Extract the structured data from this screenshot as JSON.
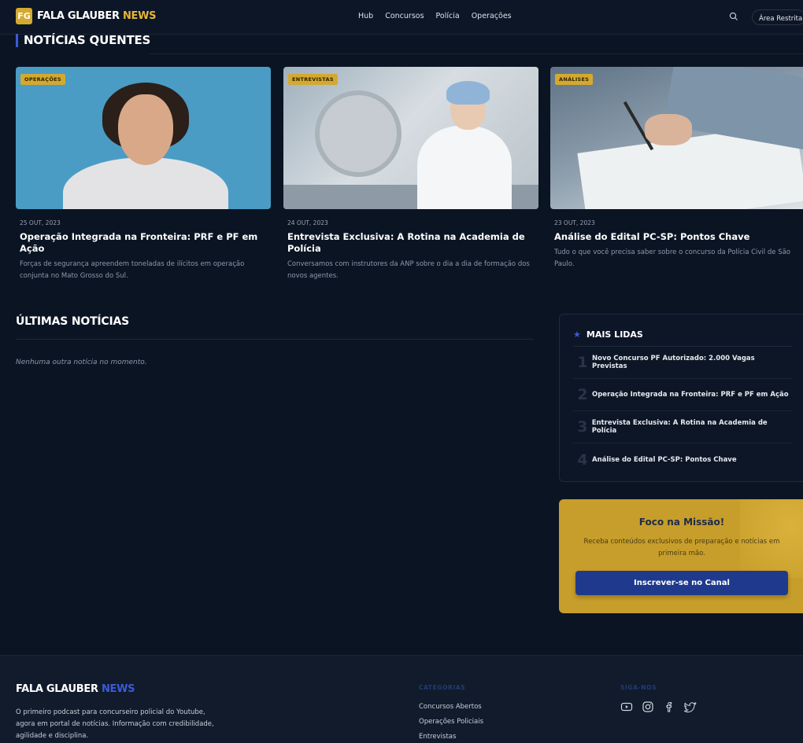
{
  "header": {
    "logo_mark": "FG",
    "logo_main": "FALA GLAUBER",
    "logo_accent": "NEWS",
    "nav": [
      "Hub",
      "Concursos",
      "Polícia",
      "Operações"
    ],
    "restricted_label": "Área Restrita"
  },
  "hot": {
    "title": "NOTÍCIAS QUENTES",
    "cards": [
      {
        "tag": "OPERAÇÕES",
        "date": "25 OUT, 2023",
        "title": "Operação Integrada na Fronteira: PRF e PF em Ação",
        "excerpt": "Forças de segurança apreendem toneladas de ilícitos em operação conjunta no Mato Grosso do Sul."
      },
      {
        "tag": "ENTREVISTAS",
        "date": "24 OUT, 2023",
        "title": "Entrevista Exclusiva: A Rotina na Academia de Polícia",
        "excerpt": "Conversamos com instrutores da ANP sobre o dia a dia de formação dos novos agentes."
      },
      {
        "tag": "ANÁLISES",
        "date": "23 OUT, 2023",
        "title": "Análise do Edital PC-SP: Pontos Chave",
        "excerpt": "Tudo o que você precisa saber sobre o concurso da Polícia Civil de São Paulo."
      }
    ]
  },
  "latest": {
    "title": "ÚLTIMAS NOTÍCIAS",
    "empty": "Nenhuma outra notícia no momento."
  },
  "most_read": {
    "title": "MAIS LIDAS",
    "items": [
      {
        "rank": "1",
        "title": "Novo Concurso PF Autorizado: 2.000 Vagas Previstas"
      },
      {
        "rank": "2",
        "title": "Operação Integrada na Fronteira: PRF e PF em Ação"
      },
      {
        "rank": "3",
        "title": "Entrevista Exclusiva: A Rotina na Academia de Polícia"
      },
      {
        "rank": "4",
        "title": "Análise do Edital PC-SP: Pontos Chave"
      }
    ]
  },
  "promo": {
    "title": "Foco na Missão!",
    "text": "Receba conteúdos exclusivos de preparação e notícias em primeira mão.",
    "button": "Inscrever-se no Canal"
  },
  "footer": {
    "logo_main": "FALA GLAUBER",
    "logo_accent": "NEWS",
    "description": "O primeiro podcast para concurseiro policial do Youtube, agora em portal de notícias. Informação com credibilidade, agilidade e disciplina.",
    "categories_title": "CATEGORIAS",
    "categories": [
      "Concursos Abertos",
      "Operações Policiais",
      "Entrevistas"
    ],
    "follow_title": "SIGA-NOS",
    "social_icons": [
      "youtube-icon",
      "instagram-icon",
      "facebook-icon",
      "twitter-icon"
    ]
  },
  "colors": {
    "accent_gold": "#d4a92f",
    "accent_blue": "#3b5bdb",
    "background": "#0b1423"
  }
}
